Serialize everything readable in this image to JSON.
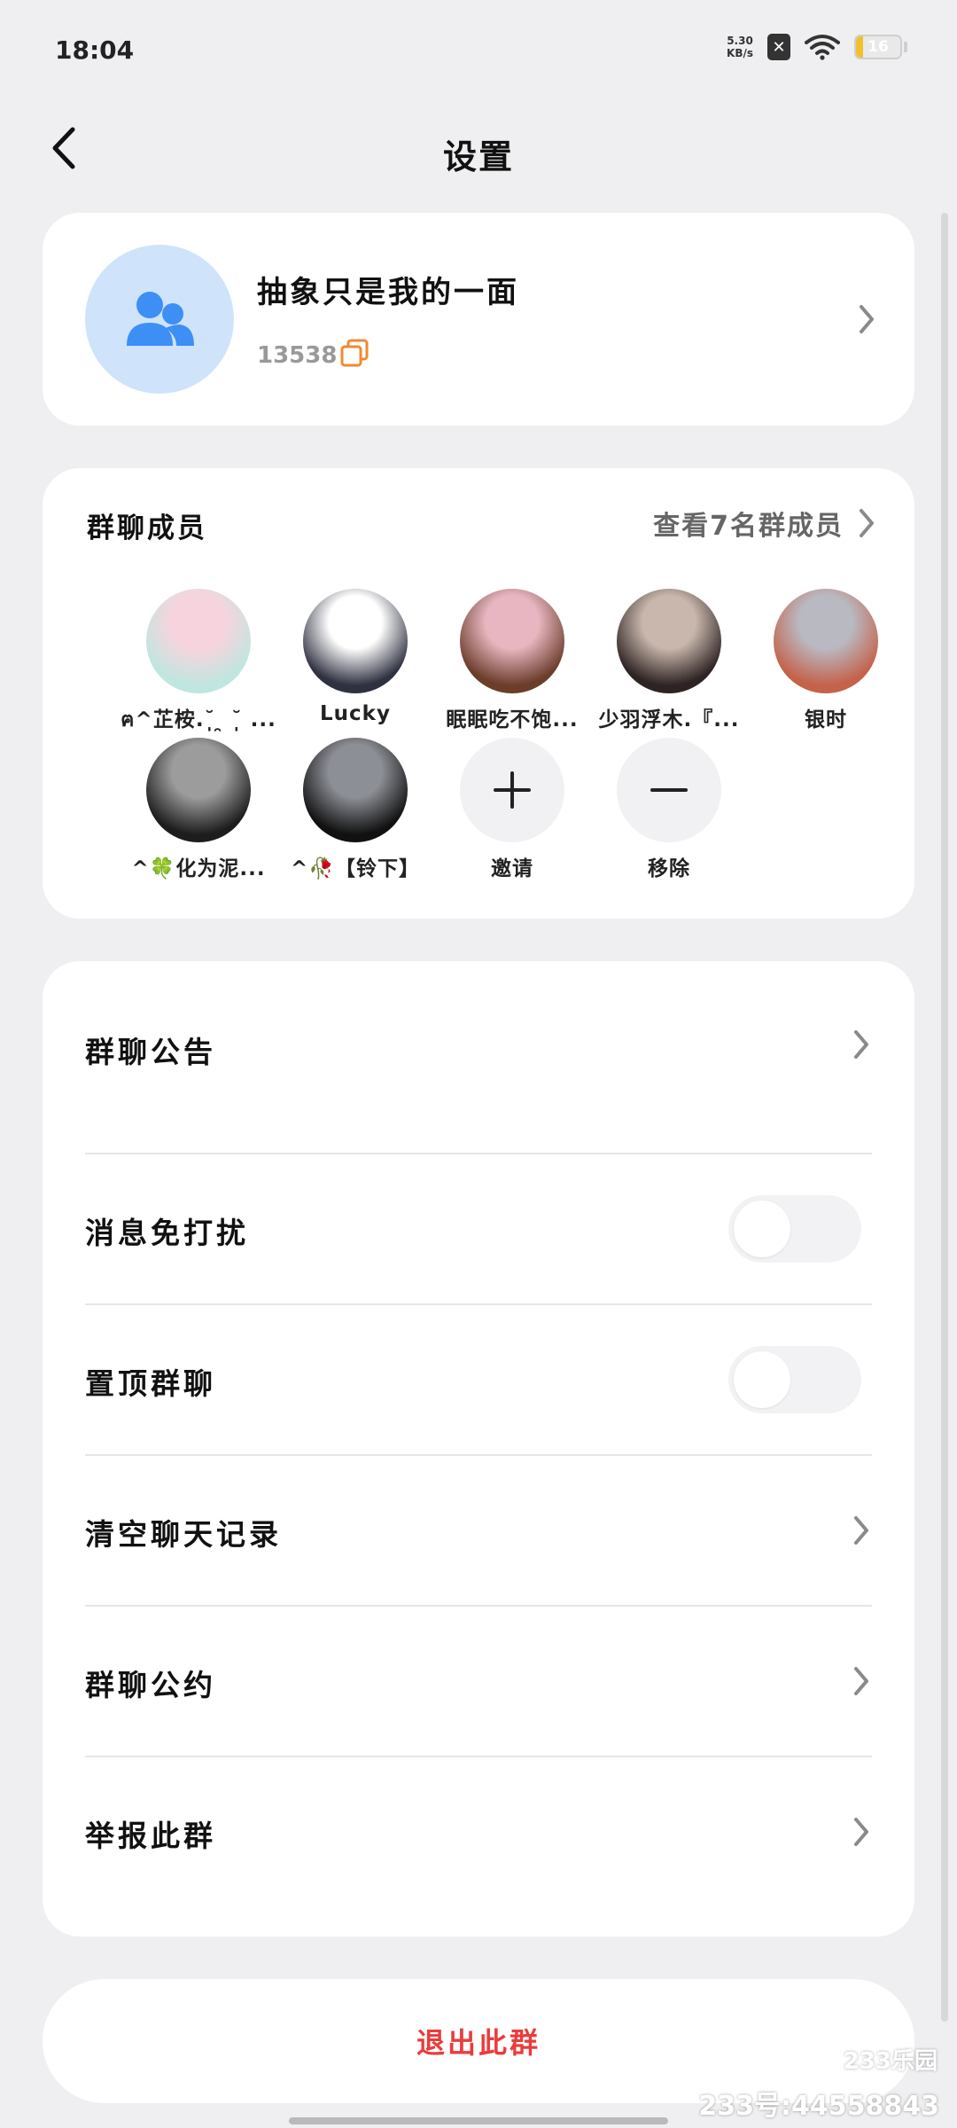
{
  "status_bar": {
    "time": "18:04",
    "net_speed_value": "5.30",
    "net_speed_unit": "KB/s",
    "battery": "16",
    "battery_level": 0.16
  },
  "header": {
    "title": "设置"
  },
  "group": {
    "name": "抽象只是我的一面",
    "id": "13538"
  },
  "members_section": {
    "title": "群聊成员",
    "view_all": "查看7名群成员",
    "members": [
      {
        "name": "ฅ^芷桉.˘̩̩̩ ̯ ˘̩̩̩ ...",
        "colors": [
          "#f7d4dd",
          "#bfe6e0"
        ]
      },
      {
        "name": "Lucky",
        "colors": [
          "#ffffff",
          "#2f3140"
        ]
      },
      {
        "name": "眠眠吃不饱...",
        "colors": [
          "#e7b6c1",
          "#6b3d2a"
        ]
      },
      {
        "name": "少羽浮木.『...",
        "colors": [
          "#c9b7ad",
          "#2d2322"
        ]
      },
      {
        "name": "银时",
        "colors": [
          "#b9b9c2",
          "#c4624a"
        ]
      },
      {
        "name": "^🍀化为泥...",
        "colors": [
          "#9c9c9c",
          "#1d1d1d"
        ]
      },
      {
        "name": "^🥀【铃下】",
        "colors": [
          "#8d8f96",
          "#111111"
        ]
      }
    ],
    "invite_label": "邀请",
    "remove_label": "移除"
  },
  "settings": {
    "announcement": "群聊公告",
    "mute": "消息免打扰",
    "pin": "置顶群聊",
    "clear_history": "清空聊天记录",
    "rules": "群聊公约",
    "report": "举报此群"
  },
  "exit_label": "退出此群",
  "watermark": {
    "logo": "233乐园",
    "text": "233号:44558843"
  },
  "colors": {
    "accent_red": "#ec3b3b",
    "avatar_blue": "#3d8ff6",
    "copy_orange": "#ef8a33"
  }
}
